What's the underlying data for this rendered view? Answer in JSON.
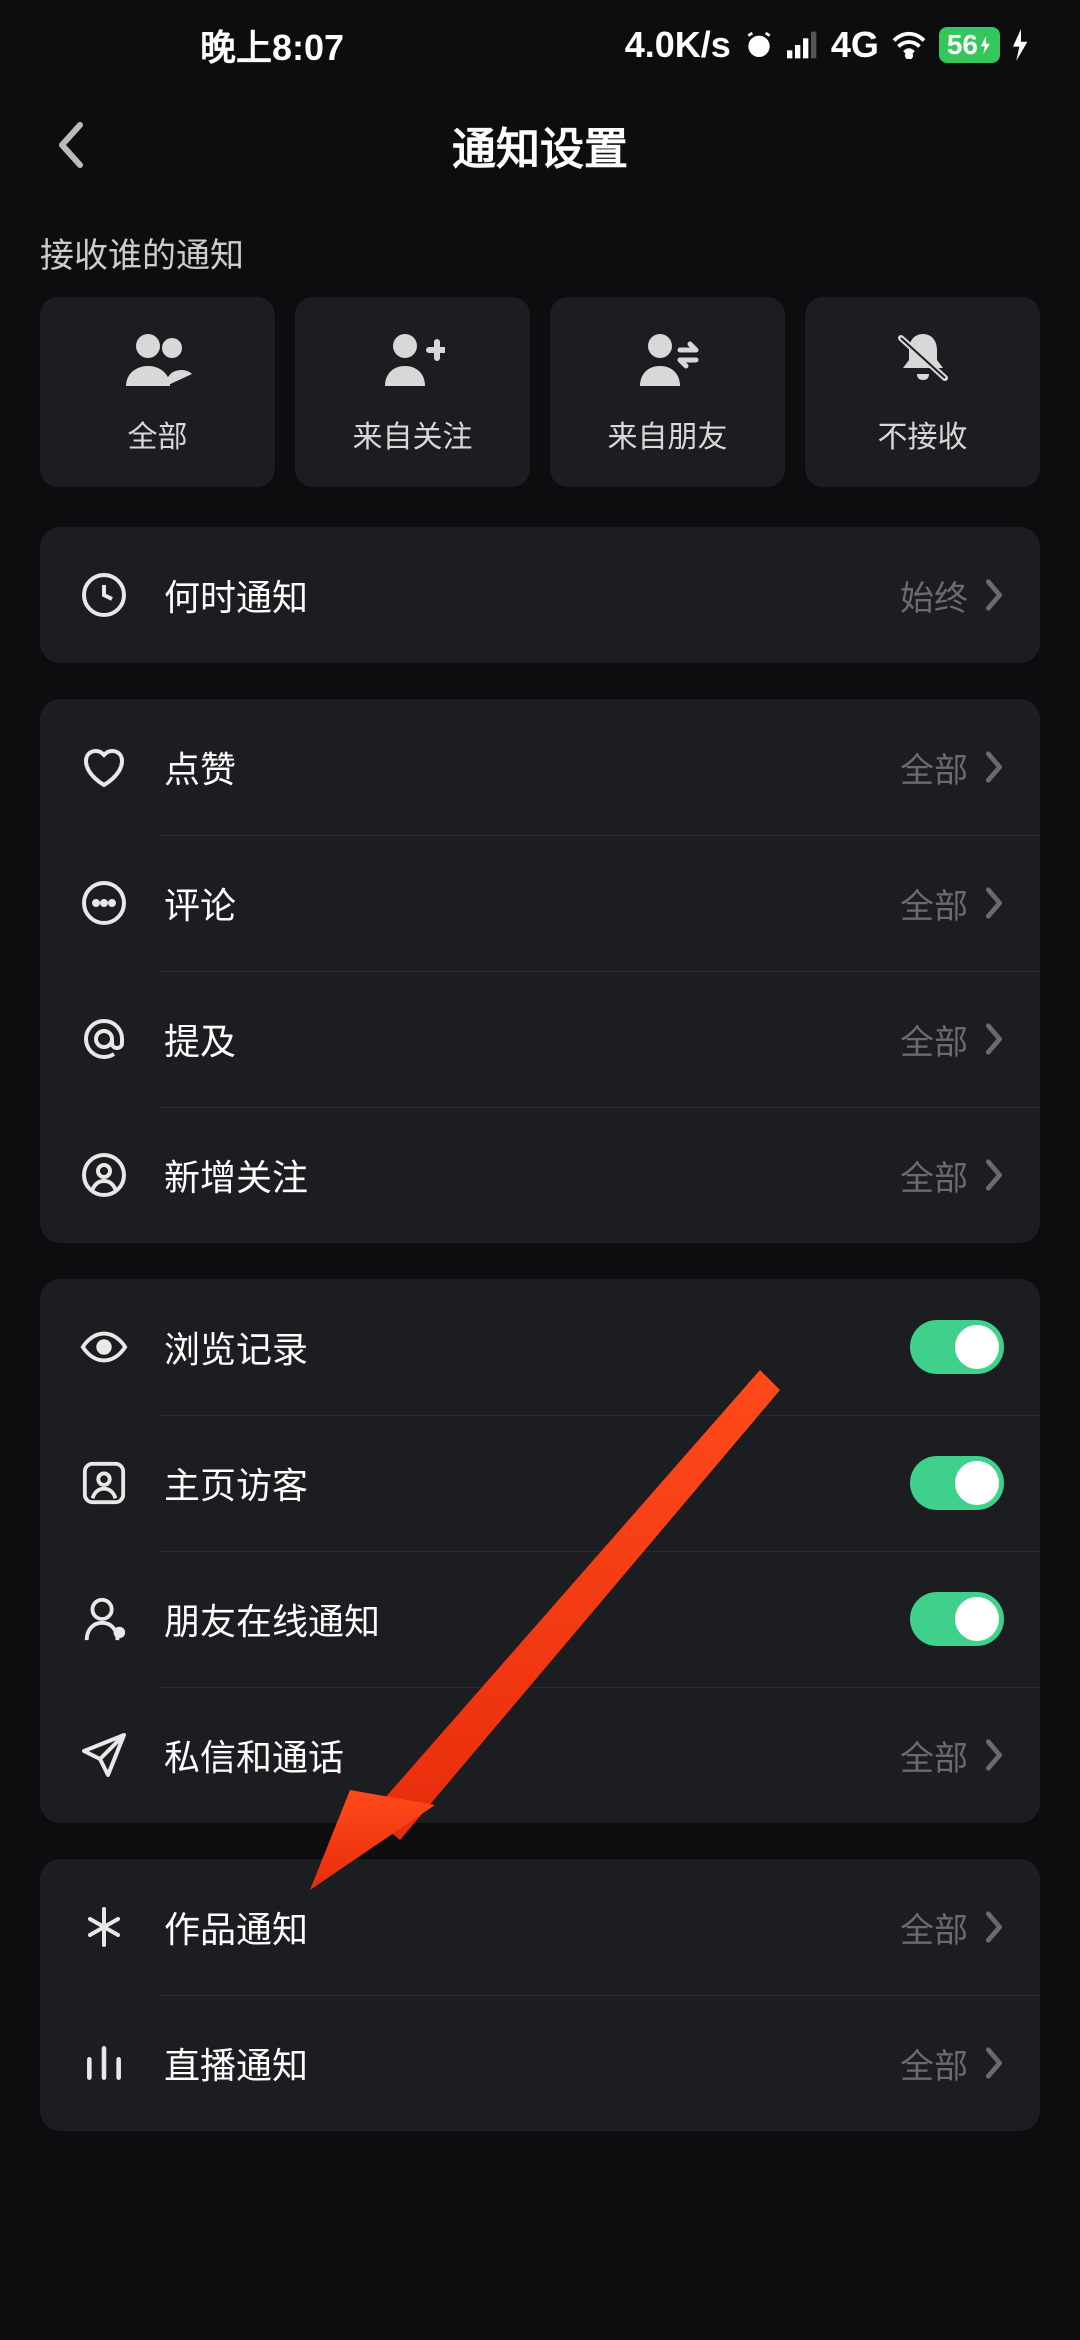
{
  "statusBar": {
    "time": "晚上8:07",
    "speed": "4.0K/s",
    "network": "4G",
    "battery": "56"
  },
  "header": {
    "title": "通知设置"
  },
  "sectionLabel": "接收谁的通知",
  "filters": {
    "all": "全部",
    "following": "来自关注",
    "friends": "来自朋友",
    "none": "不接收"
  },
  "rows": {
    "when": {
      "label": "何时通知",
      "value": "始终"
    },
    "like": {
      "label": "点赞",
      "value": "全部"
    },
    "comment": {
      "label": "评论",
      "value": "全部"
    },
    "mention": {
      "label": "提及",
      "value": "全部"
    },
    "newFollow": {
      "label": "新增关注",
      "value": "全部"
    },
    "history": {
      "label": "浏览记录"
    },
    "visitor": {
      "label": "主页访客"
    },
    "online": {
      "label": "朋友在线通知"
    },
    "dm": {
      "label": "私信和通话",
      "value": "全部"
    },
    "works": {
      "label": "作品通知",
      "value": "全部"
    },
    "live": {
      "label": "直播通知",
      "value": "全部"
    }
  }
}
